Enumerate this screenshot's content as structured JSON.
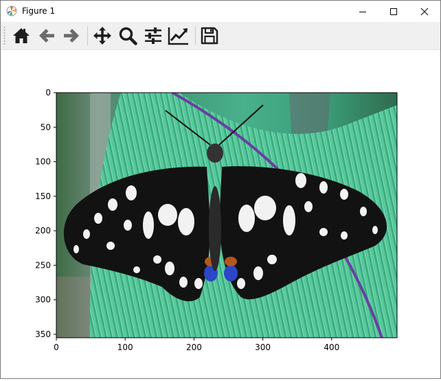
{
  "window": {
    "title": "Figure 1",
    "controls": {
      "minimize": "minimize",
      "maximize": "maximize",
      "close": "close"
    }
  },
  "toolbar": {
    "buttons": [
      {
        "name": "home-button",
        "icon": "home-icon",
        "tooltip": "Reset original view"
      },
      {
        "name": "back-button",
        "icon": "arrow-left-icon",
        "tooltip": "Back to previous view"
      },
      {
        "name": "forward-button",
        "icon": "arrow-right-icon",
        "tooltip": "Forward to next view"
      },
      {
        "name": "pan-button",
        "icon": "move-icon",
        "tooltip": "Pan axes"
      },
      {
        "name": "zoom-button",
        "icon": "magnifier-icon",
        "tooltip": "Zoom to rectangle"
      },
      {
        "name": "subplots-button",
        "icon": "sliders-icon",
        "tooltip": "Configure subplots"
      },
      {
        "name": "edit-axes-button",
        "icon": "line-chart-icon",
        "tooltip": "Edit axis"
      },
      {
        "name": "save-button",
        "icon": "floppy-disk-icon",
        "tooltip": "Save the figure"
      }
    ]
  },
  "chart_data": {
    "type": "image",
    "image_subject": "black-and-white swallowtail butterfly on a green striped leaf",
    "x_ticks": [
      "0",
      "100",
      "200",
      "300",
      "400"
    ],
    "y_ticks": [
      "0",
      "50",
      "100",
      "150",
      "200",
      "250",
      "300",
      "350"
    ],
    "xlim": [
      0,
      495
    ],
    "ylim": [
      355,
      0
    ],
    "xlabel": "",
    "ylabel": "",
    "title": ""
  },
  "colors": {
    "titlebar_bg": "#ffffff",
    "toolbar_bg": "#f0f0f0",
    "icon_dark": "#1e1e1e",
    "icon_gray": "#6b6b6b"
  }
}
